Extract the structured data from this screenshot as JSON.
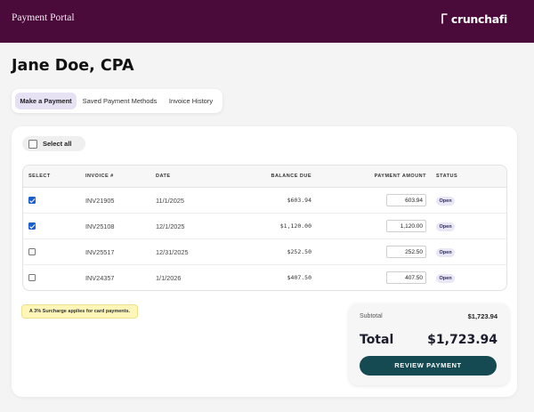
{
  "header": {
    "portal_title": "Payment Portal",
    "logo_text": "crunchafi",
    "background_color": "#4a0a3a"
  },
  "client": {
    "name": "Jane Doe, CPA"
  },
  "tabs": [
    {
      "label": "Make a Payment",
      "active": true
    },
    {
      "label": "Saved Payment Methods",
      "active": false
    },
    {
      "label": "Invoice History",
      "active": false
    }
  ],
  "select_all": {
    "label": "Select all",
    "checked": false
  },
  "table": {
    "headers": {
      "select": "SELECT",
      "invoice": "INVOICE #",
      "date": "DATE",
      "balance_due": "BALANCE DUE",
      "payment_amount": "PAYMENT AMOUNT",
      "status": "STATUS"
    },
    "rows": [
      {
        "checked": true,
        "invoice": "INV21905",
        "date": "11/1/2025",
        "balance_due": "$603.94",
        "payment_amount": "603.94",
        "status": "Open"
      },
      {
        "checked": true,
        "invoice": "INV25108",
        "date": "12/1/2025",
        "balance_due": "$1,120.00",
        "payment_amount": "1,120.00",
        "status": "Open"
      },
      {
        "checked": false,
        "invoice": "INV25517",
        "date": "12/31/2025",
        "balance_due": "$252.50",
        "payment_amount": "252.50",
        "status": "Open"
      },
      {
        "checked": false,
        "invoice": "INV24357",
        "date": "1/1/2026",
        "balance_due": "$407.50",
        "payment_amount": "407.50",
        "status": "Open"
      }
    ]
  },
  "surcharge_notice": "A 3% Surcharge applies for card payments.",
  "summary": {
    "subtotal_label": "Subtotal",
    "subtotal_value": "$1,723.94",
    "total_label": "Total",
    "total_value": "$1,723.94",
    "review_button": "REVIEW PAYMENT",
    "button_color": "#154a52"
  },
  "icons": {
    "logo": "crunchafi-logo-icon",
    "checkbox": "checkbox-icon"
  }
}
